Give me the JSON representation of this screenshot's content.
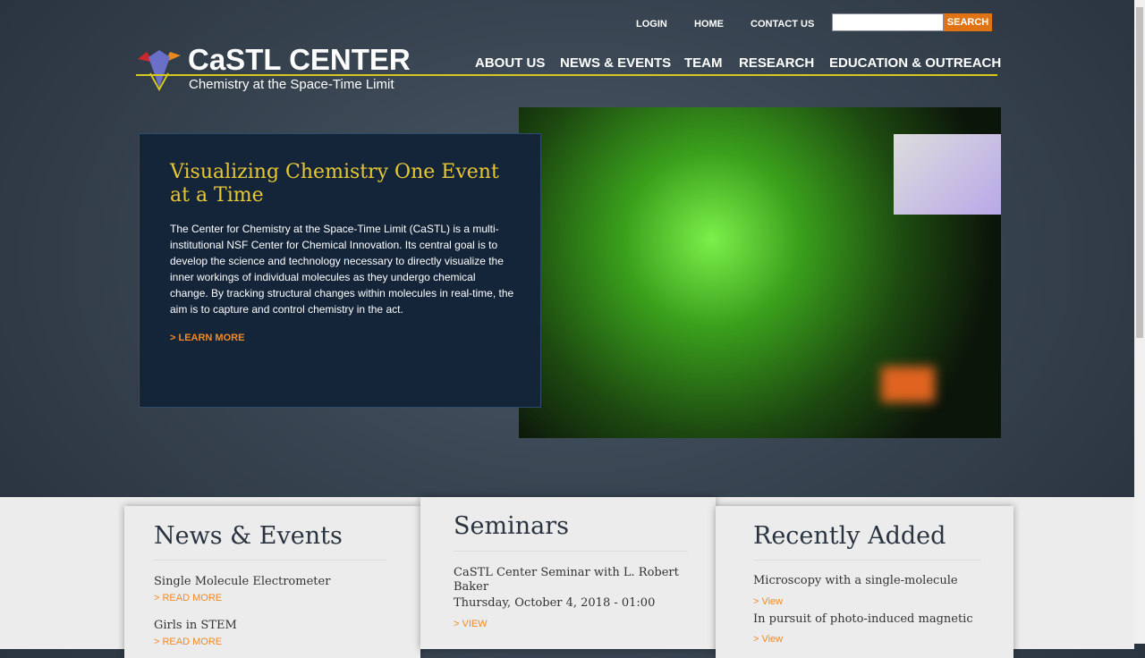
{
  "header": {
    "top_links": [
      "LOGIN",
      "HOME",
      "CONTACT US"
    ],
    "search_placeholder": "",
    "search_button": "SEARCH",
    "logo_title": "CaSTL CENTER",
    "logo_subtitle": "Chemistry at the Space-Time Limit",
    "nav": [
      "ABOUT US",
      "NEWS & EVENTS",
      "TEAM",
      "RESEARCH",
      "EDUCATION & OUTREACH"
    ]
  },
  "hero": {
    "title": "Visualizing Chemistry One Event at a Time",
    "body": "The Center for Chemistry at the Space-Time Limit (CaSTL) is a multi-institutional NSF Center for Chemical Innovation.  Its central goal is to develop the science and technology necessary to directly visualize the inner workings of individual molecules as they undergo chemical change. By tracking structural changes within molecules in real-time, the aim is to capture and control chemistry in the act.",
    "link": "> LEARN MORE"
  },
  "news": {
    "title": "News & Events",
    "items": [
      {
        "title": "Single Molecule Electrometer",
        "link": "> READ MORE"
      },
      {
        "title": "Girls in STEM",
        "link": "> READ MORE"
      }
    ]
  },
  "seminars": {
    "title": "Seminars",
    "item": {
      "title": "CaSTL Center Seminar with L. Robert Baker",
      "date": "Thursday, October 4, 2018 - 01:00",
      "link": "> VIEW"
    }
  },
  "recent": {
    "title": "Recently Added",
    "items": [
      {
        "title": "Microscopy with a single-molecule",
        "link": "> View"
      },
      {
        "title": "In pursuit of photo-induced magnetic",
        "link": "> View"
      }
    ]
  },
  "colors": {
    "accent": "#e07415",
    "hero_title": "#e8c832",
    "logo_line": "#d6c81e"
  }
}
